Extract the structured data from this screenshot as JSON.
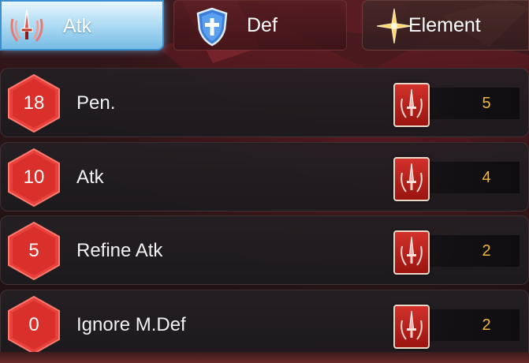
{
  "tabs": [
    {
      "label": "Atk",
      "icon": "sword-emblem-icon",
      "active": true
    },
    {
      "label": "Def",
      "icon": "shield-icon",
      "active": false
    },
    {
      "label": "Element",
      "icon": "sparkle-star-icon",
      "active": false
    }
  ],
  "rows": [
    {
      "level": "18",
      "name": "Pen.",
      "card_icon": "sword-card-icon",
      "value": "5"
    },
    {
      "level": "10",
      "name": "Atk",
      "card_icon": "sword-card-icon",
      "value": "4"
    },
    {
      "level": "5",
      "name": "Refine Atk",
      "card_icon": "sword-card-icon",
      "value": "2"
    },
    {
      "level": "0",
      "name": "Ignore M.Def",
      "card_icon": "sword-card-icon",
      "value": "2"
    }
  ],
  "colors": {
    "active_tab": "#a7d8f2",
    "badge": "#e8403a",
    "value_text": "#f0b640",
    "card_red": "#c4281f"
  }
}
